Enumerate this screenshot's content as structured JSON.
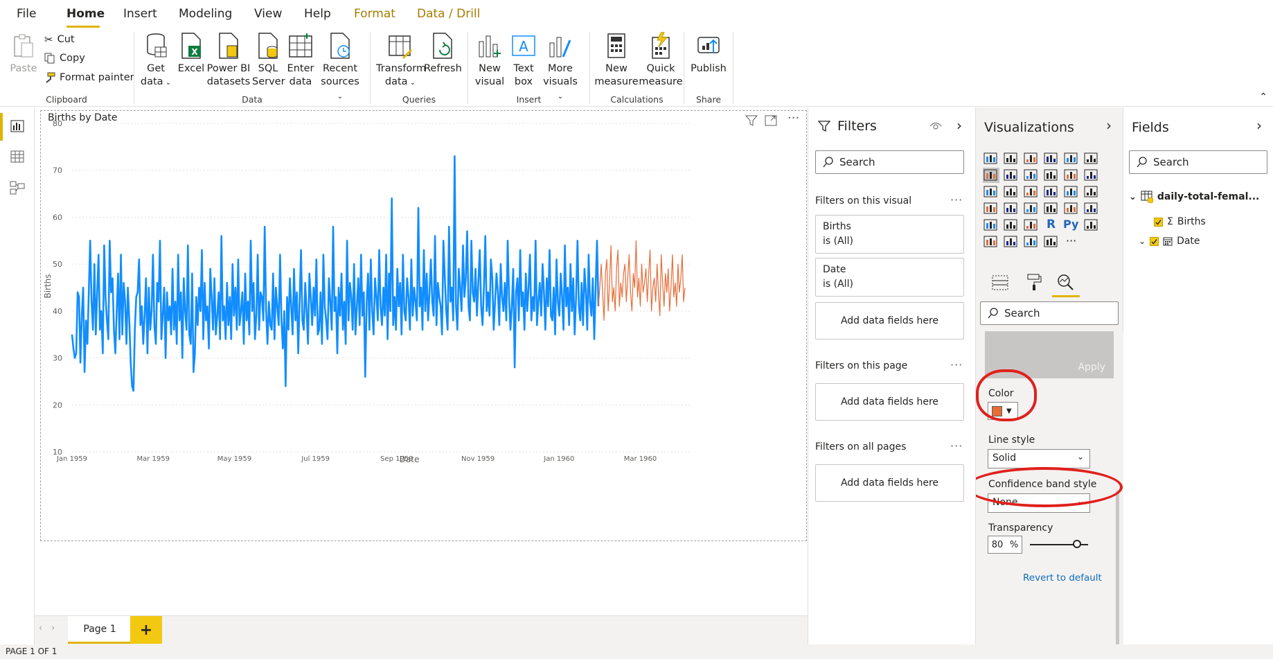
{
  "menu": {
    "tabs": [
      "File",
      "Home",
      "Insert",
      "Modeling",
      "View",
      "Help",
      "Format",
      "Data / Drill"
    ]
  },
  "ribbon": {
    "clipboard": {
      "paste": "Paste",
      "cut": "Cut",
      "copy": "Copy",
      "format_painter": "Format painter",
      "group": "Clipboard"
    },
    "data": {
      "get_data_1": "Get",
      "get_data_2": "data",
      "excel": "Excel",
      "pbi_1": "Power BI",
      "pbi_2": "datasets",
      "sql_1": "SQL",
      "sql_2": "Server",
      "enter_1": "Enter",
      "enter_2": "data",
      "recent_1": "Recent",
      "recent_2": "sources",
      "group": "Data"
    },
    "queries": {
      "transform_1": "Transform",
      "transform_2": "data",
      "refresh": "Refresh",
      "group": "Queries"
    },
    "insert": {
      "new_visual_1": "New",
      "new_visual_2": "visual",
      "text_box_1": "Text",
      "text_box_2": "box",
      "more_1": "More",
      "more_2": "visuals",
      "group": "Insert"
    },
    "calculations": {
      "new_measure_1": "New",
      "new_measure_2": "measure",
      "quick_1": "Quick",
      "quick_2": "measure",
      "group": "Calculations"
    },
    "share": {
      "publish": "Publish",
      "group": "Share"
    }
  },
  "visual": {
    "title": "Births by Date",
    "dots": "···"
  },
  "chart_data": {
    "type": "line",
    "title": "Births by Date",
    "xlabel": "Date",
    "ylabel": "Births",
    "ylim": [
      10,
      80
    ],
    "yticks": [
      10,
      20,
      30,
      40,
      50,
      60,
      70,
      80
    ],
    "xticks": [
      "Jan 1959",
      "Mar 1959",
      "May 1959",
      "Jul 1959",
      "Sep 1959",
      "Nov 1959",
      "Jan 1960",
      "Mar 1960"
    ],
    "grid": true,
    "series": [
      {
        "color": "#118dff",
        "values": [
          35,
          32,
          30,
          31,
          44,
          43,
          29,
          39,
          45,
          27,
          38,
          33,
          44,
          55,
          42,
          36,
          50,
          35,
          44,
          52,
          36,
          40,
          31,
          54,
          43,
          38,
          34,
          55,
          44,
          47,
          36,
          31,
          40,
          48,
          34,
          52,
          35,
          46,
          42,
          33,
          45,
          38,
          29,
          24,
          23,
          36,
          43,
          44,
          51,
          37,
          41,
          33,
          39,
          47,
          31,
          45,
          36,
          40,
          52,
          37,
          33,
          46,
          42,
          55,
          34,
          39,
          45,
          30,
          44,
          38,
          41,
          35,
          49,
          36,
          42,
          33,
          52,
          38,
          44,
          30,
          47,
          40,
          36,
          54,
          35,
          33,
          48,
          27,
          31,
          43,
          37,
          45,
          40,
          53,
          34,
          46,
          38,
          41,
          32,
          49,
          43,
          36,
          47,
          35,
          39,
          44,
          34,
          56,
          38,
          41,
          34,
          46,
          37,
          43,
          34,
          50,
          39,
          45,
          36,
          51,
          37,
          40,
          44,
          33,
          48,
          38,
          42,
          35,
          55,
          40,
          46,
          34,
          39,
          52,
          36,
          44,
          43,
          38,
          58,
          40,
          33,
          42,
          37,
          36,
          48,
          34,
          45,
          41,
          37,
          52,
          38,
          32,
          40,
          24,
          43,
          36,
          47,
          41,
          35,
          49,
          38,
          44,
          31,
          42,
          53,
          38,
          36,
          46,
          40,
          33,
          48,
          43,
          37,
          45,
          39,
          51,
          35,
          36,
          44,
          33,
          52,
          41,
          38,
          34,
          47,
          42,
          36,
          58,
          40,
          43,
          31,
          45,
          39,
          48,
          36,
          42,
          33,
          55,
          38,
          46,
          43,
          36,
          50,
          35,
          41,
          47,
          37,
          52,
          39,
          44,
          26,
          42,
          48,
          36,
          51,
          40,
          35,
          47,
          43,
          38,
          53,
          41,
          37,
          45,
          39,
          52,
          34,
          48,
          40,
          64,
          37,
          43,
          36,
          49,
          41,
          46,
          35,
          52,
          40,
          38,
          47,
          43,
          36,
          51,
          39,
          45,
          42,
          38,
          62,
          41,
          45,
          36,
          53,
          40,
          48,
          38,
          44,
          51,
          42,
          39,
          56,
          37,
          46,
          43,
          41,
          35,
          55,
          47,
          40,
          36,
          58,
          42,
          45,
          38,
          73,
          41,
          36,
          49,
          45,
          40,
          54,
          43,
          47,
          57,
          41,
          38,
          55,
          44,
          42,
          49,
          39,
          46,
          53,
          41,
          37,
          45,
          56,
          40,
          44,
          39,
          51,
          47,
          36,
          42,
          48,
          44,
          37,
          50,
          43,
          40,
          46,
          38,
          55,
          43,
          36,
          41,
          49,
          28,
          44,
          47,
          38,
          53,
          41,
          44,
          36,
          48,
          40,
          45,
          52,
          38,
          43,
          40,
          55,
          37,
          42,
          46,
          39,
          50,
          44,
          36,
          47,
          41,
          53,
          39,
          38,
          45,
          35,
          51,
          42,
          39,
          48,
          43,
          36,
          54,
          41,
          45,
          37,
          50,
          40,
          47,
          35,
          43,
          55,
          41,
          38,
          46,
          37,
          49,
          44,
          36,
          52,
          42,
          39,
          47,
          34,
          45,
          55,
          41
        ]
      },
      {
        "color": "#e66c37",
        "values": [
          45,
          50,
          44,
          38,
          48,
          51,
          40,
          46,
          54,
          42,
          45,
          40,
          49,
          53,
          41,
          46,
          43,
          48,
          50,
          42,
          47,
          52,
          44,
          40,
          48,
          45,
          55,
          43,
          47,
          41,
          50,
          44,
          46,
          49,
          42,
          48,
          53,
          40,
          45,
          47,
          42,
          50,
          44,
          39,
          52,
          46,
          41,
          48,
          44,
          49,
          40,
          45,
          52,
          43,
          46,
          41,
          50,
          44,
          47,
          52,
          42,
          45
        ]
      }
    ]
  },
  "filters": {
    "title": "Filters",
    "search_placeholder": "Search",
    "on_visual": "Filters on this visual",
    "births_name": "Births",
    "births_state": "is (All)",
    "date_name": "Date",
    "date_state": "is (All)",
    "add_fields": "Add data fields here",
    "on_page": "Filters on this page",
    "on_all": "Filters on all pages",
    "dots": "···"
  },
  "visualizations": {
    "title": "Visualizations",
    "search_placeholder": "Search",
    "apply": "Apply",
    "color_label": "Color",
    "color_value": "#e66c37",
    "line_style_label": "Line style",
    "line_style_value": "Solid",
    "band_label": "Confidence band style",
    "band_value": "None",
    "transparency_label": "Transparency",
    "transparency_value": "80",
    "percent": "%",
    "revert": "Revert to default",
    "r_label": "R",
    "py_label": "Py",
    "more_dots": "···"
  },
  "fields": {
    "title": "Fields",
    "search_placeholder": "Search",
    "table_name": "daily-total-femal...",
    "field_births": "Births",
    "field_date": "Date",
    "sigma": "Σ"
  },
  "bottom": {
    "page_tab": "Page 1",
    "add": "+",
    "status": "PAGE 1 OF 1"
  }
}
